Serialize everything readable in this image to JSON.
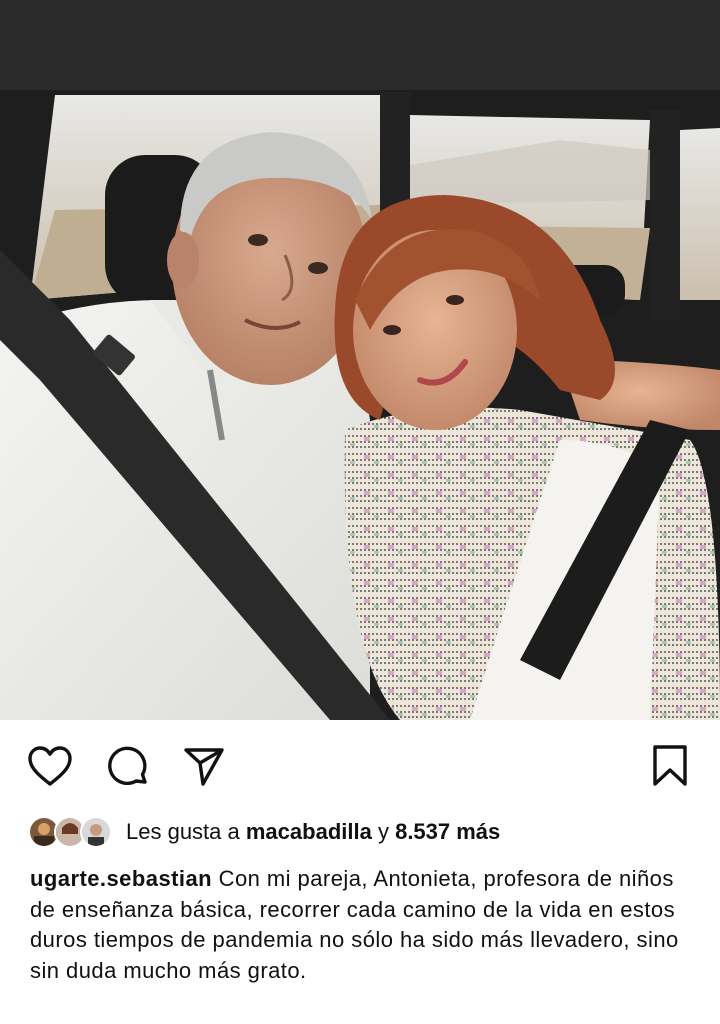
{
  "post": {
    "image_alt": "Selfie de una pareja dentro de un auto",
    "actions": {
      "like": "heart-icon",
      "comment": "comment-icon",
      "share": "share-icon",
      "save": "bookmark-icon"
    },
    "likes": {
      "prefix": "Les gusta a",
      "first_user": "macabadilla",
      "connector": "y",
      "count": "8.537 más"
    },
    "caption": {
      "username": "ugarte.sebastian",
      "text": "Con mi pareja, Antonieta, profesora de niños de enseñanza básica, recorrer cada camino de la vida en estos duros tiempos de pandemia no sólo ha sido más llevadero, sino sin duda mucho más grato."
    }
  },
  "colors": {
    "text": "#111111",
    "background": "#ffffff"
  }
}
